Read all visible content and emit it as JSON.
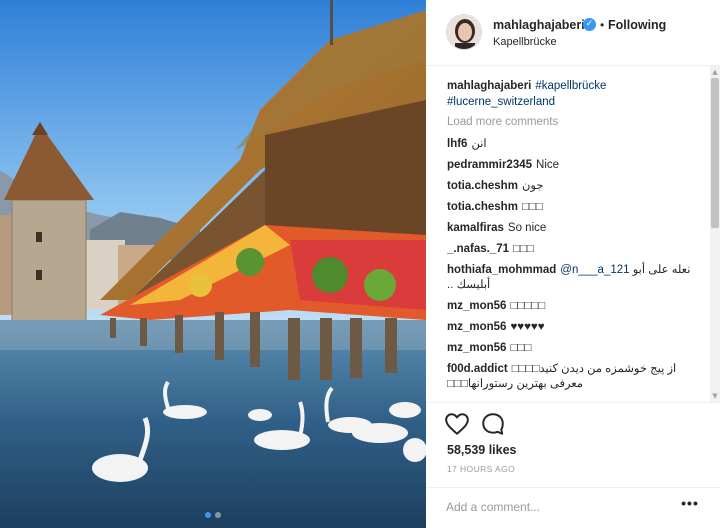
{
  "post": {
    "username": "mahlaghajaberi",
    "verified_glyph": "✓",
    "separator": "•",
    "follow_label": "Following",
    "location": "Kapellbrücke",
    "avatar_icon": "profile-photo"
  },
  "caption": {
    "username": "mahlaghajaberi",
    "tag1": "#kapellbrücke",
    "tag2": "#lucerne_switzerland"
  },
  "load_more": "Load more comments",
  "comments": [
    {
      "user": "lhf6",
      "text": "انن"
    },
    {
      "user": "pedrammir2345",
      "text": "Nice"
    },
    {
      "user": "totia.cheshm",
      "text": "جون"
    },
    {
      "user": "totia.cheshm",
      "text": "□□□"
    },
    {
      "user": "kamalfiras",
      "text": "So nice"
    },
    {
      "user": "_.nafas._71",
      "text": "□□□"
    },
    {
      "user": "hothiafa_mohmmad",
      "mention": "@n___a_121",
      "text": "نعله على أبو",
      "text2": ".. أبليسك"
    },
    {
      "user": "mz_mon56",
      "text": "□□□□□"
    },
    {
      "user": "mz_mon56",
      "text": "♥♥♥♥♥"
    },
    {
      "user": "mz_mon56",
      "text": "□□□"
    },
    {
      "user": "f00d.addict",
      "text": "□□□□از پیج خوشمزه من دیدن کنید",
      "text2": "□□□معرفی بهترین رستورانها"
    }
  ],
  "likes": "58,539 likes",
  "time": "17 HOURS AGO",
  "add_comment_placeholder": "Add a comment...",
  "more_label": "•••",
  "carousel": {
    "count": 2,
    "active": 0
  },
  "colors": {
    "accent": "#3897f0",
    "link": "#003569",
    "muted": "#999999"
  }
}
